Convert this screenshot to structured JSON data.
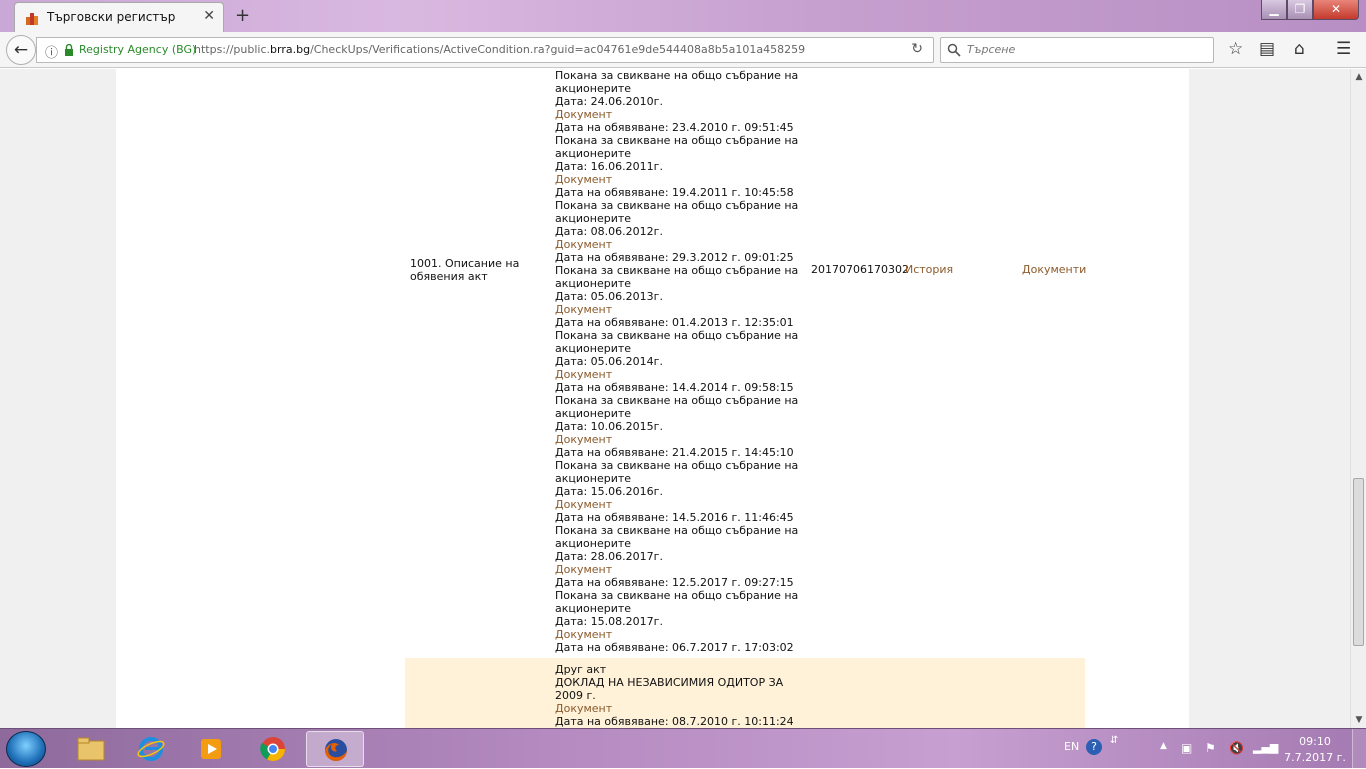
{
  "browser": {
    "tab_title": "Търговски регистър",
    "tab_close": "✕",
    "new_tab": "+",
    "site_identity": "Registry Agency (BG)",
    "url_prefix": "https://public.",
    "url_domain": "brra.bg",
    "url_path": "/CheckUps/Verifications/ActiveCondition.ra?guid=ac04761e9de544408a8b5a101a458259",
    "search_placeholder": "Търсене",
    "window_min": "▁",
    "window_max": "❐",
    "window_close": "✕"
  },
  "table": {
    "row1": {
      "name": "1001.  Описание на обявения акт",
      "number": "20170706170302",
      "history_link": "История",
      "documents_link": "Документи",
      "lines": [
        {
          "t": "Покана за свикване на общо събрание на акционерите",
          "link": false
        },
        {
          "t": "Дата: 24.06.2010г.",
          "link": false
        },
        {
          "t": "Документ",
          "link": true
        },
        {
          "t": "Дата на обявяване: 23.4.2010 г. 09:51:45",
          "link": false
        },
        {
          "t": "Покана за свикване на общо събрание на акционерите",
          "link": false
        },
        {
          "t": "Дата: 16.06.2011г.",
          "link": false
        },
        {
          "t": "Документ",
          "link": true
        },
        {
          "t": "Дата на обявяване: 19.4.2011 г. 10:45:58",
          "link": false
        },
        {
          "t": "Покана за свикване на общо събрание на акционерите",
          "link": false
        },
        {
          "t": "Дата: 08.06.2012г.",
          "link": false
        },
        {
          "t": "Документ",
          "link": true
        },
        {
          "t": "Дата на обявяване: 29.3.2012 г. 09:01:25",
          "link": false
        },
        {
          "t": "Покана за свикване на общо събрание на акционерите",
          "link": false
        },
        {
          "t": "Дата: 05.06.2013г.",
          "link": false
        },
        {
          "t": "Документ",
          "link": true
        },
        {
          "t": "Дата на обявяване: 01.4.2013 г. 12:35:01",
          "link": false
        },
        {
          "t": "Покана за свикване на общо събрание на акционерите",
          "link": false
        },
        {
          "t": "Дата: 05.06.2014г.",
          "link": false
        },
        {
          "t": "Документ",
          "link": true
        },
        {
          "t": "Дата на обявяване: 14.4.2014 г. 09:58:15",
          "link": false
        },
        {
          "t": "Покана за свикване на общо събрание на акционерите",
          "link": false
        },
        {
          "t": "Дата: 10.06.2015г.",
          "link": false
        },
        {
          "t": "Документ",
          "link": true
        },
        {
          "t": "Дата на обявяване: 21.4.2015 г. 14:45:10",
          "link": false
        },
        {
          "t": "Покана за свикване на общо събрание на акционерите",
          "link": false
        },
        {
          "t": "Дата: 15.06.2016г.",
          "link": false
        },
        {
          "t": "Документ",
          "link": true
        },
        {
          "t": "Дата на обявяване: 14.5.2016 г. 11:46:45",
          "link": false
        },
        {
          "t": "Покана за свикване на общо събрание на акционерите",
          "link": false
        },
        {
          "t": "Дата: 28.06.2017г.",
          "link": false
        },
        {
          "t": "Документ",
          "link": true
        },
        {
          "t": "Дата на обявяване: 12.5.2017 г. 09:27:15",
          "link": false
        },
        {
          "t": "Покана за свикване на общо събрание на акционерите",
          "link": false
        },
        {
          "t": "Дата: 15.08.2017г.",
          "link": false
        },
        {
          "t": "Документ",
          "link": true
        },
        {
          "t": "Дата на обявяване: 06.7.2017 г. 17:03:02",
          "link": false
        }
      ]
    },
    "row2": {
      "lines": [
        {
          "t": "Друг акт",
          "link": false
        },
        {
          "t": "ДОКЛАД НА НЕЗАВИСИМИЯ ОДИТОР ЗА 2009 г.",
          "link": false
        },
        {
          "t": "Документ",
          "link": true
        },
        {
          "t": "Дата на обявяване: 08.7.2010 г. 10:11:24",
          "link": false
        }
      ]
    }
  },
  "taskbar": {
    "language": "EN",
    "help": "?",
    "time": "09:10",
    "date": "7.7.2017 г."
  },
  "colors": {
    "link": "#8b5a2b",
    "row_highlight": "#fff2d9",
    "secure_green": "#2a8a2a"
  }
}
